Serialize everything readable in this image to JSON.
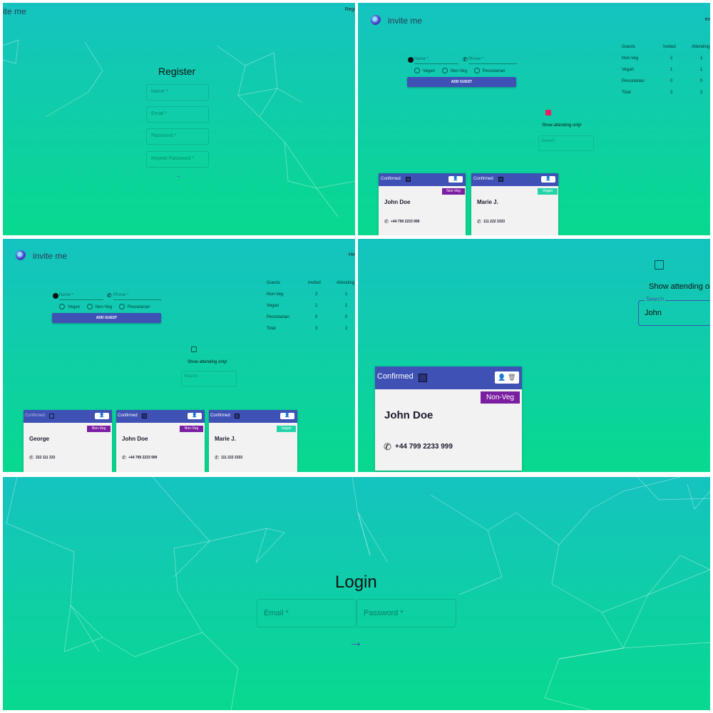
{
  "app": {
    "name": "invite me"
  },
  "register": {
    "brand_partial": "ite me",
    "nav_partial": "Regi",
    "title": "Register",
    "fields": [
      "Name *",
      "Email *",
      "Password *",
      "Repeat Password *"
    ],
    "submit": "→"
  },
  "dashboard": {
    "nav_partial_p2": "ex",
    "nav_partial_p3": "He",
    "name_label": "Name *",
    "phone_label": "Phone *",
    "diets": [
      "Vegan",
      "Non-Veg",
      "Pescetarian"
    ],
    "add_guest": "ADD GUEST",
    "table_headers": [
      "Guests",
      "Invited",
      "Attending"
    ],
    "table_rows_p2": [
      {
        "label": "Non-Veg",
        "invited": "2",
        "attending": "1"
      },
      {
        "label": "Vegan",
        "invited": "1",
        "attending": "1"
      },
      {
        "label": "Pescetarian",
        "invited": "0",
        "attending": "0"
      },
      {
        "label": "Total",
        "invited": "3",
        "attending": "2"
      }
    ],
    "table_rows_p3": [
      {
        "label": "Non-Veg",
        "invited": "2",
        "attending": "1"
      },
      {
        "label": "Vegan",
        "invited": "1",
        "attending": "1"
      },
      {
        "label": "Pescetarian",
        "invited": "0",
        "attending": "0"
      },
      {
        "label": "Total",
        "invited": "3",
        "attending": "2"
      }
    ],
    "show_attending": "Show attending only!",
    "search_placeholder": "Search",
    "cards_p2": [
      {
        "status": "Confirmed",
        "name": "John Doe",
        "diet": "Non-Veg",
        "phone": "+44 799 2233 999"
      },
      {
        "status": "Confirmed",
        "name": "Marie J.",
        "diet": "Vegan",
        "phone": "111 222 3333"
      }
    ],
    "cards_p3": [
      {
        "status": "Confirmed",
        "name": "George",
        "diet": "Non-Veg",
        "phone": "222 111 333"
      },
      {
        "status": "Confirmed",
        "name": "John Doe",
        "diet": "Non-Veg",
        "phone": "+44 799 2233 999"
      },
      {
        "status": "Confirmed",
        "name": "Marie J.",
        "diet": "Vegan",
        "phone": "111 222 3333"
      }
    ]
  },
  "search_view": {
    "show_attending_partial": "Show attending or",
    "search_label": "Search",
    "search_value": "John",
    "card": {
      "status": "Confirmed",
      "name": "John Doe",
      "diet": "Non-Veg",
      "phone": "+44 799 2233 999"
    }
  },
  "login": {
    "title": "Login",
    "email": "Email *",
    "password": "Password *",
    "submit": "→"
  },
  "colors": {
    "bg_top": "#15c3c0",
    "bg_bottom": "#08d98e",
    "primary": "#3f51b5",
    "nonveg": "#7b1fa2",
    "vegan": "#26d3a9",
    "checkbox_on": "#e91e63"
  }
}
